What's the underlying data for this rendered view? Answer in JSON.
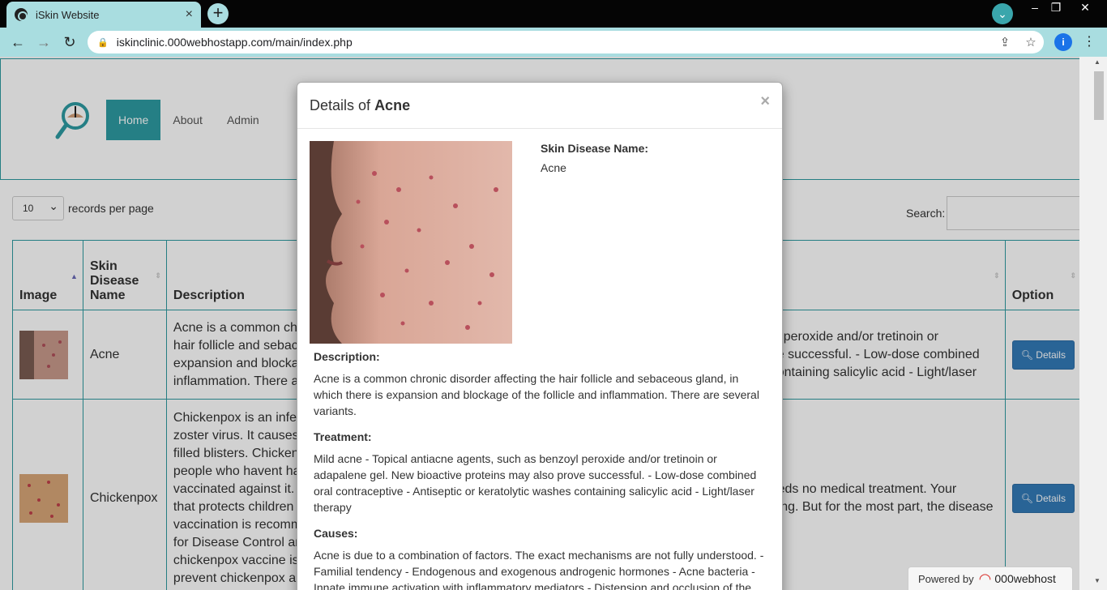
{
  "browser": {
    "tab_title": "iSkin Website",
    "tab_close": "×",
    "new_tab": "+",
    "url": "iskinclinic.000webhostapp.com/main/index.php",
    "profile_initial": "i"
  },
  "nav": {
    "items": [
      "Home",
      "About",
      "Admin"
    ],
    "active": "Home"
  },
  "table_controls": {
    "page_length": "10",
    "page_length_label": "records per page",
    "search_label": "Search:"
  },
  "table": {
    "headers": [
      "Image",
      "Skin Disease Name",
      "Description",
      "",
      "Option"
    ],
    "rows": [
      {
        "name": "Acne",
        "desc": [
          "Acne is a common ch",
          "hair follicle and sebac",
          "expansion and blocka",
          "inflammation. There a"
        ],
        "treat": [
          "yl peroxide and/or tretinoin or",
          "ve successful. - Low-dose combined",
          "containing salicylic acid - Light/laser"
        ],
        "button": "Details"
      },
      {
        "name": "Chickenpox",
        "desc": [
          "Chickenpox is an infe",
          "zoster virus. It causes",
          "filled blisters. Chicken",
          "people who havent ha",
          "vaccinated against it.",
          "that protects children",
          "vaccination is recomm",
          "for Disease Control ar",
          "chickenpox vaccine is",
          "prevent chickenpox ar"
        ],
        "treat": [
          "eeds no medical treatment. Your",
          "ning. But for the most part, the disease"
        ],
        "button": "Details"
      }
    ]
  },
  "modal": {
    "title_prefix": "Details of",
    "title_name": "Acne",
    "close": "×",
    "name_label": "Skin Disease Name:",
    "name_value": "Acne",
    "description_label": "Description:",
    "description": "Acne is a common chronic disorder affecting the hair follicle and sebaceous gland, in which there is expansion and blockage of the follicle and inflammation. There are several variants.",
    "treatment_label": "Treatment:",
    "treatment": "Mild acne - Topical antiacne agents, such as benzoyl peroxide and/or tretinoin or adapalene gel. New bioactive proteins may also prove successful. - Low-dose combined oral contraceptive - Antiseptic or keratolytic washes containing salicylic acid - Light/laser therapy",
    "causes_label": "Causes:",
    "causes": "Acne is due to a combination of factors. The exact mechanisms are not fully understood. - Familial tendency - Endogenous and exogenous androgenic hormones - Acne bacteria - Innate immune activation with inflammatory mediators - Distension and occlusion of the"
  },
  "footer_badge": {
    "powered_label": "Powered by",
    "brand": "000webhost"
  },
  "colors": {
    "accent": "#2e9ca3",
    "button": "#337ab7",
    "chrome": "#a9dde0"
  }
}
